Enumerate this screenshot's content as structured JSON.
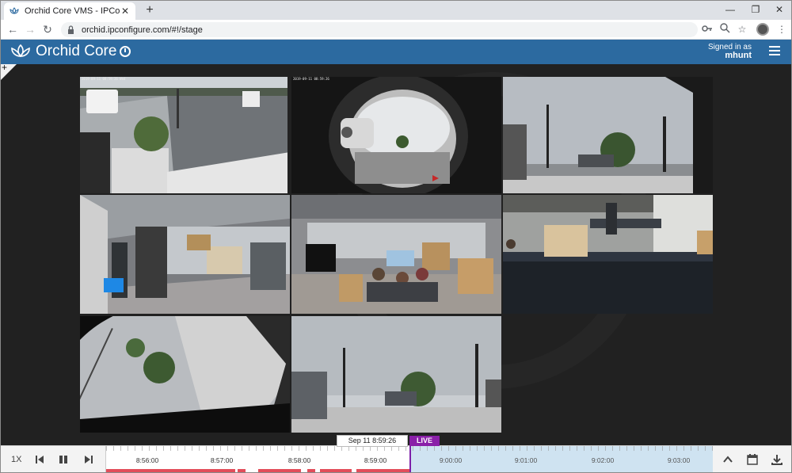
{
  "browser": {
    "tab_title": "Orchid Core VMS - IPConfigure, I",
    "url": "orchid.ipconfigure.com/#!/stage",
    "new_tab": "+",
    "tab_close": "✕",
    "win_minimize": "—",
    "win_restore": "❐",
    "win_close": "✕",
    "nav_back": "←",
    "nav_forward": "→",
    "nav_reload": "↻",
    "icons": [
      "key-icon",
      "zoom-icon",
      "star-icon",
      "avatar",
      "more-icon"
    ]
  },
  "header": {
    "brand": "Orchid Core",
    "signed_in_label": "Signed in as",
    "username": "mhunt",
    "accent": "#2c6aa0"
  },
  "stage": {
    "corner_add": "+",
    "cameras": [
      {
        "timestamp": "2019-09-11 08:59:26  Wed"
      },
      {
        "timestamp": "2019-09-11 08:59:26"
      },
      {
        "timestamp": ""
      },
      {
        "timestamp": ""
      },
      {
        "timestamp": ""
      },
      {
        "timestamp": ""
      },
      {
        "timestamp": ""
      },
      {
        "timestamp": ""
      }
    ]
  },
  "timeline": {
    "speed": "1X",
    "current_time": "Sep 11 8:59:26",
    "live_label": "LIVE",
    "past_labels": [
      "8:56:00",
      "8:57:00",
      "8:58:00",
      "8:59:00"
    ],
    "future_labels": [
      "9:00:00",
      "9:01:00",
      "9:02:00",
      "9:03:00"
    ],
    "colors": {
      "recording": "#e24d5a",
      "future": "#cfe3f1",
      "live": "#8a1fa8"
    }
  }
}
